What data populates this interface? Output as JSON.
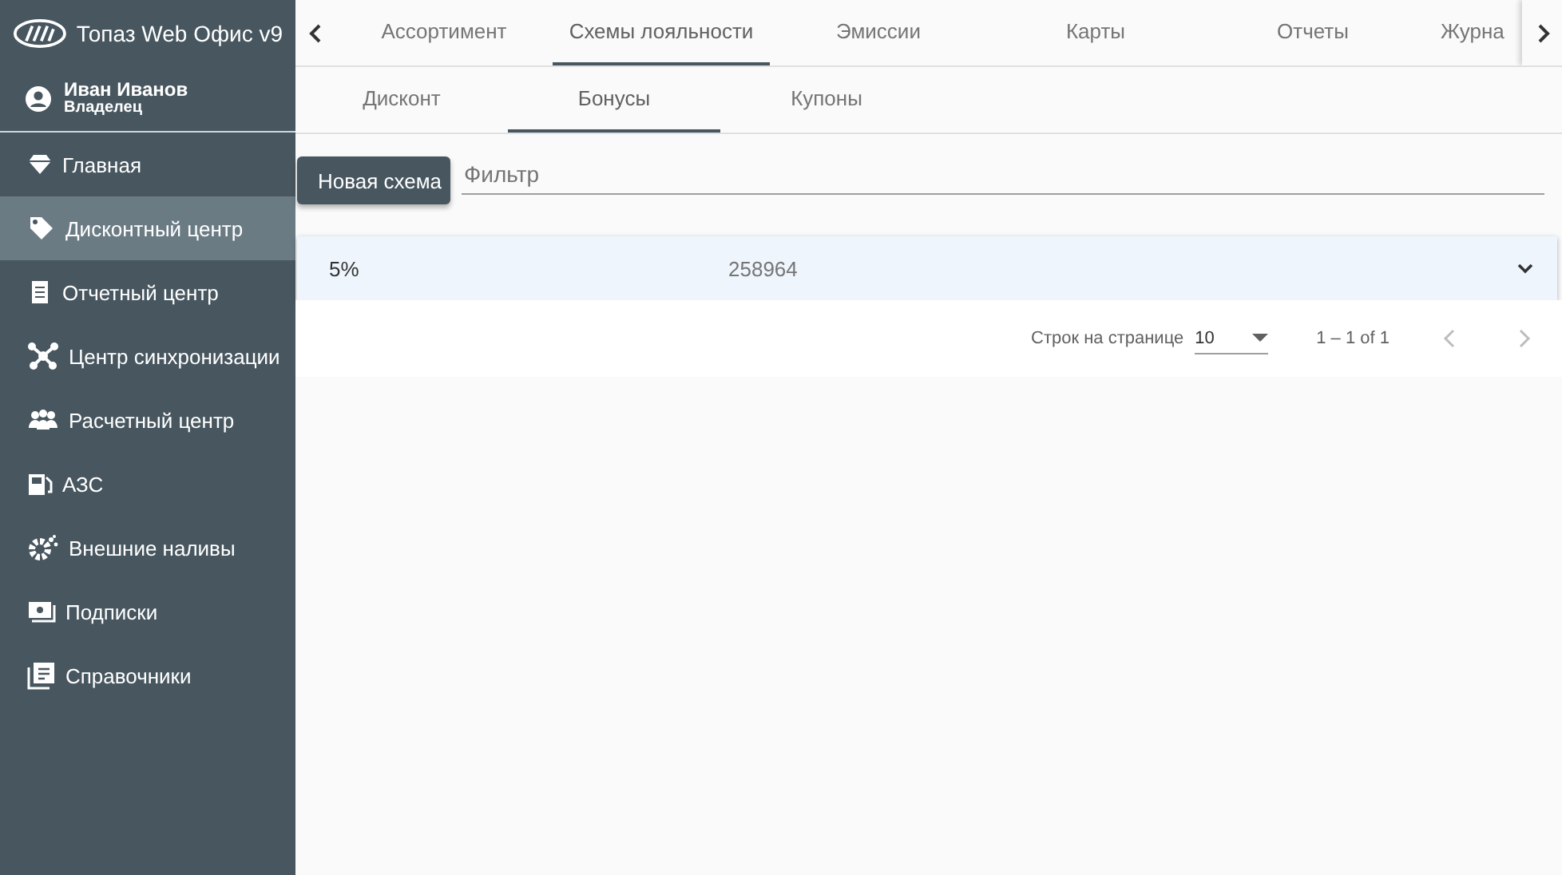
{
  "app": {
    "title": "Топаз Web Офис v9"
  },
  "user": {
    "name": "Иван Иванов",
    "role": "Владелец"
  },
  "sidebar": {
    "items": [
      {
        "label": "Главная",
        "selected": false
      },
      {
        "label": "Дисконтный центр",
        "selected": true
      },
      {
        "label": "Отчетный центр",
        "selected": false
      },
      {
        "label": "Центр синхронизации",
        "selected": false
      },
      {
        "label": "Расчетный центр",
        "selected": false
      },
      {
        "label": "АЗС",
        "selected": false
      },
      {
        "label": "Внешние наливы",
        "selected": false
      },
      {
        "label": "Подписки",
        "selected": false
      },
      {
        "label": "Справочники",
        "selected": false
      }
    ]
  },
  "tabs": [
    {
      "label": "Ассортимент",
      "selected": false
    },
    {
      "label": "Схемы лояльности",
      "selected": true
    },
    {
      "label": "Эмиссии",
      "selected": false
    },
    {
      "label": "Карты",
      "selected": false
    },
    {
      "label": "Отчеты",
      "selected": false
    },
    {
      "label": "Журна",
      "selected": false
    }
  ],
  "subtabs": [
    {
      "label": "Дисконт",
      "selected": false
    },
    {
      "label": "Бонусы",
      "selected": true
    },
    {
      "label": "Купоны",
      "selected": false
    }
  ],
  "new_button": "Новая схема",
  "filter": {
    "placeholder": "Фильтр"
  },
  "rows": [
    {
      "column_1": "5%",
      "column_2": "258964",
      "expanded": false
    }
  ],
  "paginator": {
    "label": "Строк на странице",
    "page_size": "10",
    "range": "1 – 1 of 1"
  }
}
